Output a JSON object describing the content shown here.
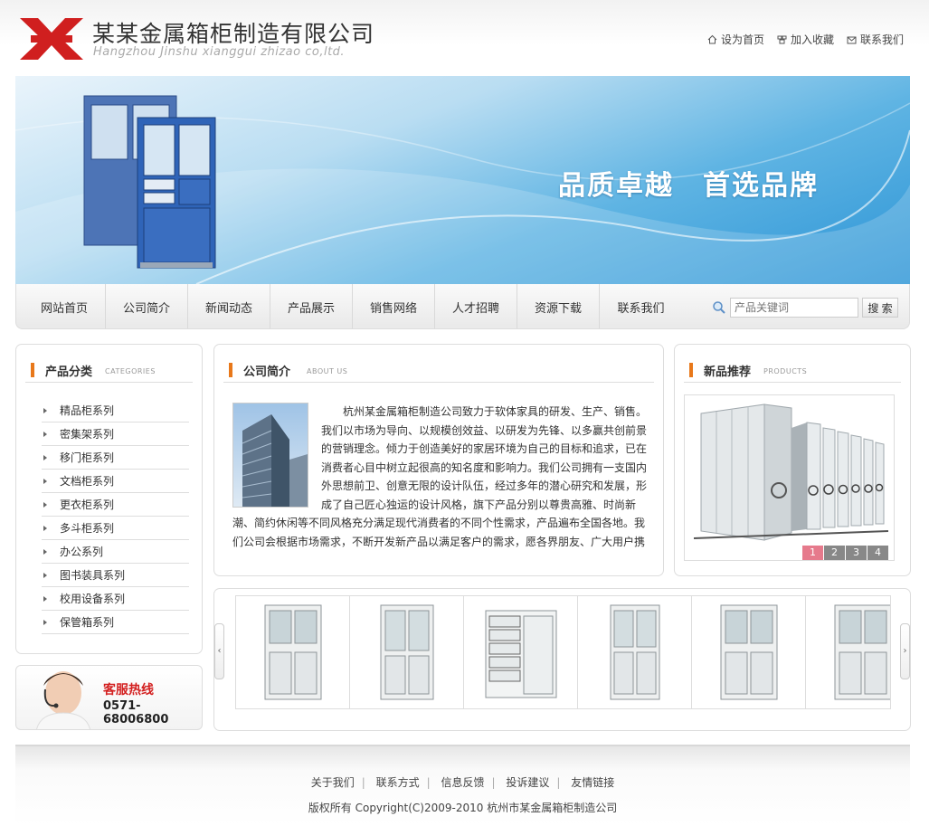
{
  "header": {
    "company_name": "某某金属箱柜制造有限公司",
    "company_en": "Hangzhou Jinshu xianggui zhizao co,ltd.",
    "top_links": [
      "设为首页",
      "加入收藏",
      "联系我们"
    ]
  },
  "banner": {
    "slogan": "品质卓越　首选品牌"
  },
  "nav": {
    "items": [
      "网站首页",
      "公司简介",
      "新闻动态",
      "产品展示",
      "销售网络",
      "人才招聘",
      "资源下载",
      "联系我们"
    ],
    "search_placeholder": "产品关键词",
    "search_button": "搜 索"
  },
  "categories": {
    "title": "产品分类",
    "subtitle": "CATEGORIES",
    "items": [
      "精品柜系列",
      "密集架系列",
      "移门柜系列",
      "文档柜系列",
      "更衣柜系列",
      "多斗柜系列",
      "办公系列",
      "图书装具系列",
      "校用设备系列",
      "保管箱系列"
    ]
  },
  "about": {
    "title": "公司简介",
    "subtitle": "ABOUT US",
    "text": "杭州某金属箱柜制造公司致力于软体家具的研发、生产、销售。我们以市场为导向、以规模创效益、以研发为先锋、以多赢共创前景的营销理念。倾力于创造美好的家居环境为自己的目标和追求，已在消费者心目中树立起很高的知名度和影响力。我们公司拥有一支国内外思想前卫、创意无限的设计队伍，经过多年的潜心研究和发展，形成了自己匠心独运的设计风格，旗下产品分别以尊贵高雅、时尚新潮、简约休闲等不同风格充分满足现代消费者的不同个性需求，产品遍布全国各地。我们公司会根据市场需求，不断开发新产品以满足客户的需求，愿各界朋友、广大用户携"
  },
  "new_products": {
    "title": "新品推荐",
    "subtitle": "PRODUCTS",
    "pages": [
      "1",
      "2",
      "3",
      "4"
    ]
  },
  "hotline": {
    "label": "客服热线",
    "phone": "0571-68006800"
  },
  "footer": {
    "links": [
      "关于我们",
      "联系方式",
      "信息反馈",
      "投诉建议",
      "友情链接"
    ],
    "copyright": "版权所有  Copyright(C)2009-2010 杭州市某金属箱柜制造公司"
  },
  "colors": {
    "accent_orange": "#e8781a",
    "banner_blue": "#2d95d6",
    "logo_red": "#d01f1f",
    "hotline_red": "#d32020",
    "page_active": "#e67a8c"
  }
}
